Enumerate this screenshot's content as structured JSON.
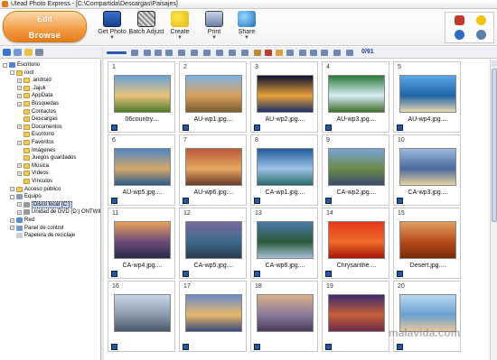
{
  "window": {
    "title": "Ulead Photo Express - [C:\\Compartida\\Descargas\\Paisajes]"
  },
  "mode": {
    "edit_label": "Edit",
    "browse_label": "Browse"
  },
  "toolbar": {
    "get_photo": "Get Photo",
    "batch_adjust": "Batch Adjust",
    "create": "Create",
    "print": "Print",
    "share": "Share"
  },
  "icons": [
    "home-icon",
    "tip-icon",
    "help-icon",
    "search-icon"
  ],
  "content_toolbar": {
    "count": "0/91"
  },
  "tree": [
    {
      "label": "Escritorio",
      "level": 0,
      "icon": "desk",
      "exp": "-"
    },
    {
      "label": "root",
      "level": 1,
      "icon": "folder",
      "exp": "-"
    },
    {
      "label": ".android",
      "level": 2,
      "icon": "folder",
      "exp": "+"
    },
    {
      "label": ".Jajuk",
      "level": 2,
      "icon": "folder",
      "exp": "+"
    },
    {
      "label": "AppData",
      "level": 2,
      "icon": "folder",
      "exp": "+"
    },
    {
      "label": "Búsquedas",
      "level": 2,
      "icon": "folder",
      "exp": "+"
    },
    {
      "label": "Contactos",
      "level": 2,
      "icon": "folder",
      "exp": ""
    },
    {
      "label": "Descargas",
      "level": 2,
      "icon": "folder",
      "exp": ""
    },
    {
      "label": "Documentos",
      "level": 2,
      "icon": "folder",
      "exp": "+"
    },
    {
      "label": "Escritorio",
      "level": 2,
      "icon": "folder",
      "exp": ""
    },
    {
      "label": "Favoritos",
      "level": 2,
      "icon": "folder",
      "exp": "+"
    },
    {
      "label": "Imágenes",
      "level": 2,
      "icon": "folder",
      "exp": ""
    },
    {
      "label": "Juegos guardados",
      "level": 2,
      "icon": "folder",
      "exp": ""
    },
    {
      "label": "Música",
      "level": 2,
      "icon": "folder",
      "exp": "+"
    },
    {
      "label": "Vídeos",
      "level": 2,
      "icon": "folder",
      "exp": "+"
    },
    {
      "label": "Vínculos",
      "level": 2,
      "icon": "folder",
      "exp": ""
    },
    {
      "label": "Acceso público",
      "level": 1,
      "icon": "folder",
      "exp": "+"
    },
    {
      "label": "Equipo",
      "level": 1,
      "icon": "pc",
      "exp": "-"
    },
    {
      "label": "Disco local (C:)",
      "level": 2,
      "icon": "disk",
      "exp": "+",
      "selected": true
    },
    {
      "label": "Unidad de DVD (D:) ONTWIN",
      "level": 2,
      "icon": "disk",
      "exp": "+"
    },
    {
      "label": "Red",
      "level": 1,
      "icon": "net",
      "exp": "+"
    },
    {
      "label": "Panel de control",
      "level": 1,
      "icon": "panel",
      "exp": "+"
    },
    {
      "label": "Papelera de reciclaje",
      "level": 1,
      "icon": "trash",
      "exp": ""
    }
  ],
  "photos": [
    {
      "n": "1",
      "name": "06country....",
      "colors": [
        "#6aa3d6",
        "#e9c27a",
        "#4f7a2b"
      ]
    },
    {
      "n": "2",
      "name": "AU-wp1.jpg....",
      "colors": [
        "#7fb2e3",
        "#d8a25c",
        "#7a5b2e"
      ]
    },
    {
      "n": "3",
      "name": "AU-wp2.jpg....",
      "colors": [
        "#0b1230",
        "#e8a23a",
        "#1c2f6a"
      ]
    },
    {
      "n": "4",
      "name": "AU-wp3.jpg....",
      "colors": [
        "#2a7a3a",
        "#d9eef7",
        "#3b6c2a"
      ]
    },
    {
      "n": "5",
      "name": "AU-wp4.jpg....",
      "colors": [
        "#5aa6e6",
        "#1f63a7",
        "#e9d8b0"
      ]
    },
    {
      "n": "6",
      "name": "AU-wp5.jpg....",
      "colors": [
        "#4f86c2",
        "#d6a86a",
        "#2c5a8a"
      ]
    },
    {
      "n": "7",
      "name": "AU-wp6.jpg....",
      "colors": [
        "#b85a3a",
        "#e7a860",
        "#6a3a2a"
      ]
    },
    {
      "n": "8",
      "name": "CA-wp1.jpg....",
      "colors": [
        "#1f5a9a",
        "#9ec3e6",
        "#2a6a6a"
      ]
    },
    {
      "n": "9",
      "name": "CA-wp2.jpg....",
      "colors": [
        "#7aa4d6",
        "#6a8a4a",
        "#3a4a6a"
      ]
    },
    {
      "n": "10",
      "name": "CA-wp3.jpg....",
      "colors": [
        "#9bb8e0",
        "#4a6a9a",
        "#e6d2a2"
      ]
    },
    {
      "n": "11",
      "name": "CA-wp4.jpg....",
      "colors": [
        "#e8a25a",
        "#6a4a7a",
        "#2a2a4a"
      ]
    },
    {
      "n": "12",
      "name": "CA-wp5.jpg....",
      "colors": [
        "#7a6aa0",
        "#3a6a8a",
        "#2a3a4a"
      ]
    },
    {
      "n": "13",
      "name": "CA-wp6.jpg....",
      "colors": [
        "#4a7aa8",
        "#2a5a3a",
        "#a8c0d8"
      ]
    },
    {
      "n": "14",
      "name": "Chrysanthe....",
      "colors": [
        "#e23a1a",
        "#f06a2a",
        "#a8180a"
      ]
    },
    {
      "n": "15",
      "name": "Desert.jpg....",
      "colors": [
        "#e0a060",
        "#b84a1a",
        "#7a2a0a"
      ]
    },
    {
      "n": "16",
      "name": "",
      "colors": [
        "#c8d8ea",
        "#8a9aaa",
        "#4a5a6a"
      ]
    },
    {
      "n": "17",
      "name": "",
      "colors": [
        "#6a8ac8",
        "#e8b86a",
        "#3a4a7a"
      ]
    },
    {
      "n": "18",
      "name": "",
      "colors": [
        "#d8b08a",
        "#8a7a9a",
        "#4a3a5a"
      ]
    },
    {
      "n": "19",
      "name": "",
      "colors": [
        "#3a2a6a",
        "#c8603a",
        "#6a2a4a"
      ]
    },
    {
      "n": "20",
      "name": "",
      "colors": [
        "#b8d8f0",
        "#6aa0d0",
        "#e8c89a"
      ]
    }
  ],
  "watermark": "malavida.com"
}
